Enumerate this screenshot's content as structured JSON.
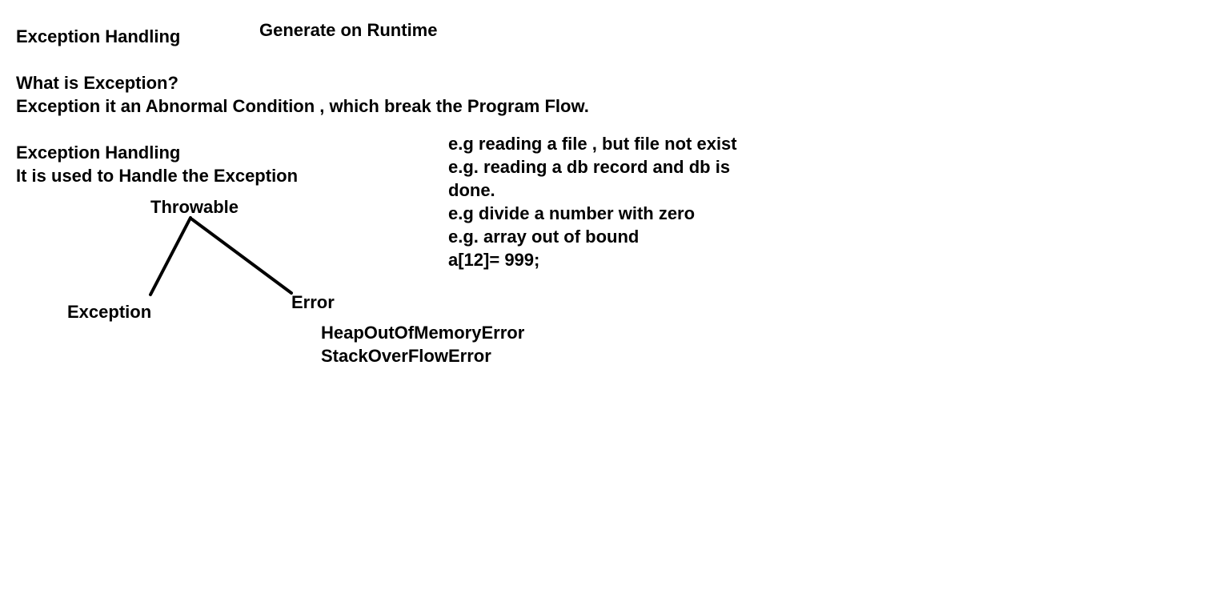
{
  "notes": {
    "heading": "Exception Handling",
    "runtime_note": "Generate on Runtime",
    "question": "What is Exception?",
    "definition": "Exception it an Abnormal Condition , which break the Program Flow.",
    "handling_heading": "Exception Handling",
    "handling_definition": "It is used to Handle the Exception"
  },
  "examples": [
    "e.g reading a file , but file not exist",
    "e.g. reading a db record and db is",
    "done.",
    "e.g divide a number with zero",
    "e.g. array out of bound",
    "a[12]= 999;"
  ],
  "hierarchy": {
    "root": "Throwable",
    "left_child": "Exception",
    "right_child": "Error",
    "error_types": [
      "HeapOutOfMemoryError",
      "StackOverFlowError"
    ]
  },
  "colors": {
    "ink": "#000000",
    "background": "#ffffff"
  }
}
